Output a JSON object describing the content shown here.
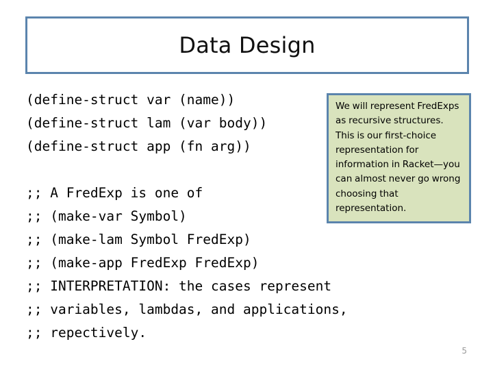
{
  "slide": {
    "title": "Data Design",
    "page_number": "5",
    "accent_color": "#5b84ad",
    "callout_fill_color": "#d9e3bd",
    "text_color": "#000000",
    "page_number_color": "#9a9a9a",
    "background_color": "#ffffff"
  },
  "code": {
    "lines": [
      "(define-struct var (name))",
      "(define-struct lam (var body))",
      "(define-struct app (fn arg))",
      "",
      ";; A FredExp is one of",
      ";; (make-var Symbol)",
      ";; (make-lam Symbol FredExp)",
      ";; (make-app FredExp FredExp)",
      ";; INTERPRETATION: the cases represent",
      ";; variables, lambdas, and applications,",
      ";; repectively."
    ]
  },
  "callout": {
    "body": "We will represent FredExps as recursive structures. This is our first-choice representation for information in Racket—you can almost never go wrong choosing that representation."
  }
}
